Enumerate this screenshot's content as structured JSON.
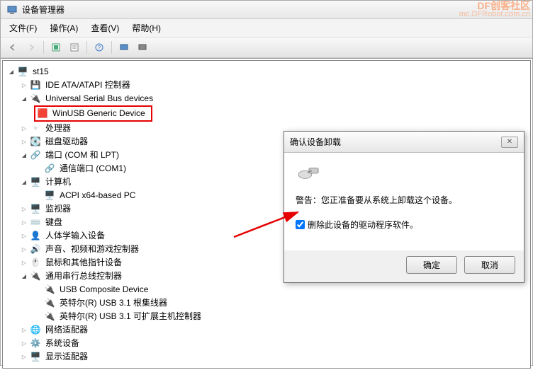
{
  "window": {
    "title": "设备管理器"
  },
  "menu": {
    "file": "文件(F)",
    "action": "操作(A)",
    "view": "查看(V)",
    "help": "帮助(H)"
  },
  "tree": {
    "root": "st15",
    "ide": "IDE ATA/ATAPI 控制器",
    "usb_devices": "Universal Serial Bus devices",
    "winusb": "WinUSB Generic Device",
    "cpu": "处理器",
    "disk": "磁盘驱动器",
    "ports": "端口 (COM 和 LPT)",
    "com1": "通信端口 (COM1)",
    "computer": "计算机",
    "acpi": "ACPI x64-based PC",
    "monitor": "监视器",
    "keyboard": "键盘",
    "hid": "人体学输入设备",
    "sound": "声音、视频和游戏控制器",
    "mouse": "鼠标和其他指针设备",
    "usb_ctrl": "通用串行总线控制器",
    "usb_composite": "USB Composite Device",
    "usb31_root": "英特尔(R) USB 3.1 根集线器",
    "usb31_ext": "英特尔(R) USB 3.1 可扩展主机控制器",
    "network": "网络适配器",
    "sysdev": "系统设备",
    "display": "显示适配器"
  },
  "dialog": {
    "title": "确认设备卸载",
    "warning": "警告：您正准备要从系统上卸载这个设备。",
    "checkbox_label": "删除此设备的驱动程序软件。",
    "checkbox_checked": true,
    "ok": "确定",
    "cancel": "取消"
  },
  "watermark": {
    "brand": "DF创客社区",
    "url": "mc.DFRobot.com.cn"
  }
}
